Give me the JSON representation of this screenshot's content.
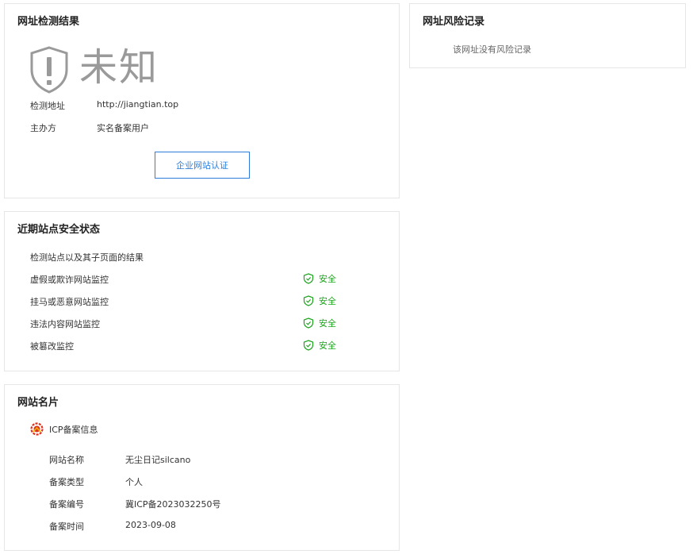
{
  "result": {
    "title": "网址检测结果",
    "verdict": "未知",
    "url_label": "检测地址",
    "url_value": "http://jiangtian.top",
    "owner_label": "主办方",
    "owner_value": "实名备案用户",
    "cert_button": "企业网站认证"
  },
  "risk": {
    "title": "网址风险记录",
    "empty_text": "该网址没有风险记录"
  },
  "status": {
    "title": "近期站点安全状态",
    "description": "检测站点以及其子页面的结果",
    "rows": [
      {
        "name": "虚假或欺诈网站监控",
        "status": "安全"
      },
      {
        "name": "挂马或恶意网站监控",
        "status": "安全"
      },
      {
        "name": "违法内容网站监控",
        "status": "安全"
      },
      {
        "name": "被篡改监控",
        "status": "安全"
      }
    ],
    "safe_color": "#1ca41c"
  },
  "namecard": {
    "title": "网站名片",
    "icp_header": "ICP备案信息",
    "fields": [
      {
        "label": "网站名称",
        "value": "无尘日记silcano"
      },
      {
        "label": "备案类型",
        "value": "个人"
      },
      {
        "label": "备案编号",
        "value": "冀ICP备2023032250号"
      },
      {
        "label": "备案时间",
        "value": "2023-09-08"
      }
    ]
  },
  "icons": {
    "verdict_icon": "shield-exclamation-icon",
    "safe_icon": "shield-check-icon",
    "icp_icon": "icp-badge-icon"
  },
  "colors": {
    "accent": "#2f7ddb",
    "safe": "#1ca41c",
    "verdict_gray": "#9a9a9a"
  }
}
